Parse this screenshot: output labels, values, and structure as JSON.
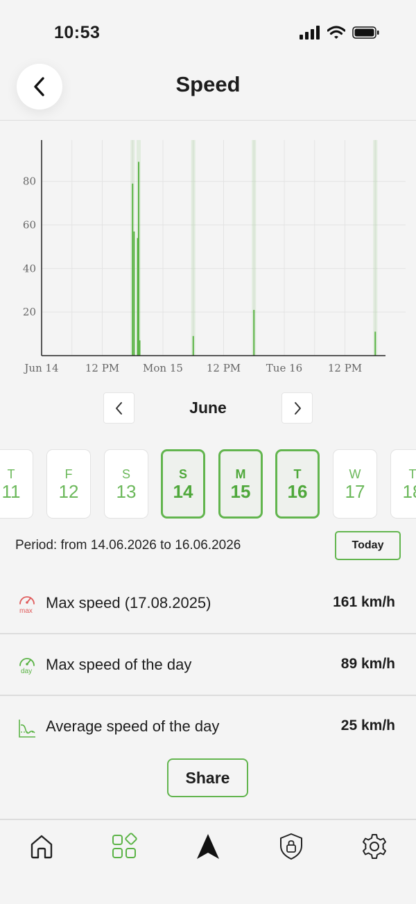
{
  "status_bar": {
    "time": "10:53"
  },
  "header": {
    "title": "Speed"
  },
  "chart_data": {
    "type": "bar",
    "title": "",
    "xlabel": "",
    "ylabel": "",
    "x_tick_labels": [
      "Jun 14",
      "12 PM",
      "Mon 15",
      "12 PM",
      "Tue 16",
      "12 PM"
    ],
    "y_tick_labels": [
      "20",
      "40",
      "60",
      "80"
    ],
    "ylim": [
      0,
      99
    ],
    "grid": true,
    "x_unit": "hours since Jun 14 00:00",
    "series": [
      {
        "color": "#5ab345",
        "points": [
          {
            "x": 18.0,
            "y": 79
          },
          {
            "x": 18.3,
            "y": 57
          },
          {
            "x": 19.0,
            "y": 54
          },
          {
            "x": 19.2,
            "y": 89
          },
          {
            "x": 19.4,
            "y": 7
          },
          {
            "x": 30.0,
            "y": 9
          },
          {
            "x": 42.0,
            "y": 21
          },
          {
            "x": 66.0,
            "y": 11
          }
        ]
      }
    ]
  },
  "calendar": {
    "month": "June",
    "days": [
      {
        "letter": "T",
        "number": "11",
        "selected": false
      },
      {
        "letter": "F",
        "number": "12",
        "selected": false
      },
      {
        "letter": "S",
        "number": "13",
        "selected": false
      },
      {
        "letter": "S",
        "number": "14",
        "selected": true
      },
      {
        "letter": "M",
        "number": "15",
        "selected": true
      },
      {
        "letter": "T",
        "number": "16",
        "selected": true
      },
      {
        "letter": "W",
        "number": "17",
        "selected": false
      },
      {
        "letter": "T",
        "number": "18",
        "selected": false
      }
    ]
  },
  "period": {
    "text": "Period: from 14.06.2026 to 16.06.2026",
    "today_label": "Today"
  },
  "stats": [
    {
      "icon": "max-speed-gauge-icon",
      "icon_text": "max",
      "label": "Max speed (17.08.2025)",
      "value": "161 km/h",
      "color": "#e05c5c"
    },
    {
      "icon": "day-speed-gauge-icon",
      "icon_text": "day",
      "label": "Max speed of the day",
      "value": "89 km/h",
      "color": "#5ab345"
    },
    {
      "icon": "average-speed-chart-icon",
      "label": "Average speed of the day",
      "value": "25 km/h",
      "color": "#5ab345"
    }
  ],
  "share_label": "Share",
  "tabbar": {
    "items": [
      "home-icon",
      "apps-grid-icon",
      "navigation-arrow-icon",
      "shield-lock-icon",
      "settings-gear-icon"
    ],
    "accent": "#5ab345"
  }
}
